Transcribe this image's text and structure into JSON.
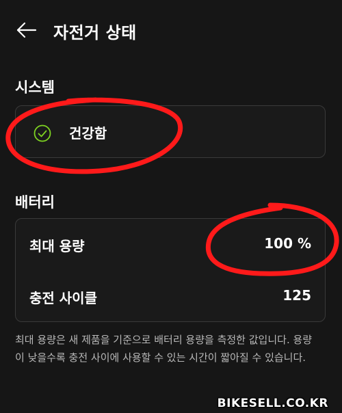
{
  "header": {
    "title": "자전거 상태"
  },
  "system": {
    "section_label": "시스템",
    "status": "건강함"
  },
  "battery": {
    "section_label": "배터리",
    "rows": [
      {
        "label": "최대 용량",
        "value": "100 %"
      },
      {
        "label": "충전 사이클",
        "value": "125"
      }
    ],
    "note": "최대 용량은 새 제품을 기준으로 배터리 용량을 측정한 값입니다. 용량이 낮을수록 충전 사이에 사용할 수 있는 시간이 짧아질 수 있습니다."
  },
  "watermark": "BIKESELL.CO.KR",
  "colors": {
    "background": "#161616",
    "check_accent": "#7ed321",
    "annotation_red": "#ff1a1a"
  },
  "icons": {
    "back": "arrow-left-icon",
    "status": "check-circle-icon"
  }
}
